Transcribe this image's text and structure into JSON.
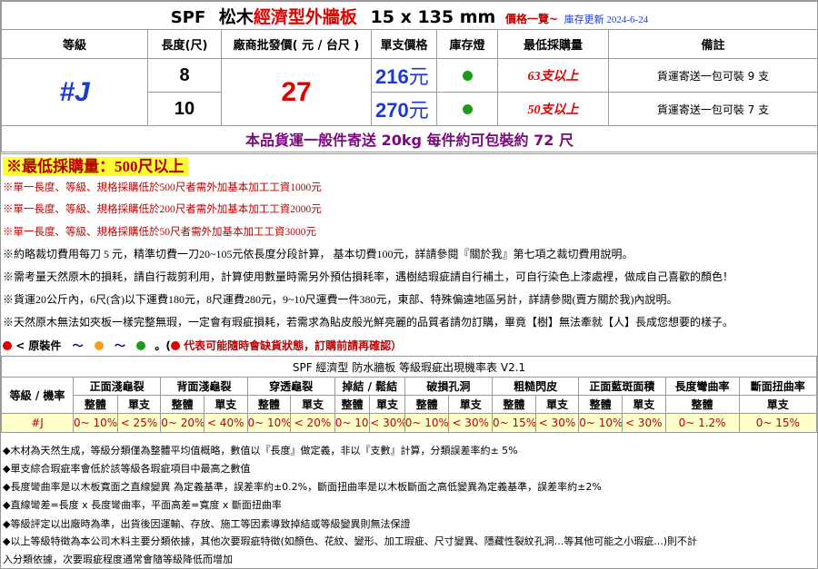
{
  "title": {
    "spf": "SPF",
    "brand": "松木",
    "type": "經濟型外牆板",
    "size": "15 x 135 mm",
    "list": "價格一覽~",
    "update": "庫存更新 2024-6-24"
  },
  "headers": {
    "grade": "等級",
    "length": "長度(尺)",
    "wholesale": "廠商批發價( 元 / 台尺 )",
    "unit_price": "單支價格",
    "stock": "庫存燈",
    "min_buy": "最低採購量",
    "remark": "備註"
  },
  "product": {
    "grade": "#J",
    "wholesale": "27",
    "rows": [
      {
        "length": "8",
        "price": "216",
        "unit": "元",
        "min_buy": "63支以上",
        "remark": "貨運寄送一包可裝 9 支"
      },
      {
        "length": "10",
        "price": "270",
        "unit": "元",
        "min_buy": "50支以上",
        "remark": "貨運寄送一包可裝 7 支"
      }
    ],
    "stock_color": "#1a9b1a",
    "shipping_note": "本品貨運一般件寄送 20kg 每件約可包裝約 72 尺"
  },
  "notes": {
    "min_banner": "※最低採購量：500尺以上",
    "lines_red": [
      "※單一長度、等級、規格採購低於500尺者需外加基本加工工資1000元",
      "※單一長度、等級、規格採購低於200尺者需外加基本加工工資2000元",
      "※單一長度、等級、規格採購低於50尺者需外加基本加工工資3000元"
    ],
    "lines_black": [
      "※約略裁切費用每刀 5 元，精準切費一刀20~105元依長度分段計算， 基本切費100元，詳請參閱『關於我』第七項之裁切費用說明。",
      "※需考量天然原木的損耗，請自行裁剪利用，計算使用數量時需另外預估損耗率，遇樹結瑕疵請自行補土，可自行染色上漆處裡，做成自己喜歡的顏色！",
      "※貨運20公斤內，6尺(含)以下運費180元，8尺運費280元，9~10尺運費一件380元，東部、特殊偏遠地區另計，詳請參閱(賣方關於我)內說明。",
      "※天然原木無法如夾板一樣完整無瑕，一定會有瑕疵損耗，若需求為貼皮般光鮮亮麗的品質者請勿訂購，畢竟【樹】無法牽就【人】長成您想要的樣子。"
    ],
    "legend_label": "< 原裝件",
    "legend_tilde": "～",
    "legend_red_text": "代表可能隨時會缺貨狀態，訂購前請再確認）",
    "legend_colors": [
      "#e00000",
      "#ff9a1a",
      "#1a9b1a"
    ]
  },
  "defect_table": {
    "title": "SPF 經濟型 防水牆板 等級瑕疵出現機率表 V2.1",
    "row_header": "等級 / 機率",
    "groups": [
      "正面淺龜裂",
      "背面淺龜裂",
      "穿透龜裂",
      "掉結 / 鬆結",
      "破損孔洞",
      "粗糙閃皮",
      "正面藍斑面積",
      "長度彎曲率",
      "斷面扭曲率"
    ],
    "sub_whole": "整體",
    "sub_single": "單支",
    "grade": "#J",
    "values": [
      "0~ 10%",
      "< 25%",
      "0~ 20%",
      "< 40%",
      "0~ 10%",
      "< 20%",
      "0~ 10%",
      "< 30%",
      "0~ 10%",
      "< 30%",
      "0~ 15%",
      "< 30%",
      "0~ 10%",
      "< 30%",
      "0~ 1.2%",
      "0~ 15%"
    ]
  },
  "footnotes": [
    "◆木材為天然生成，等級分類僅為整體平均值概略，數值以『長度』做定義，非以『支數』計算，分類誤差率約± 5%",
    "◆單支綜合瑕疵率會低於該等級各瑕疵項目中最高之數值",
    "◆長度彎曲率是以木板寬面之直線變異 為定義基準，誤差率約±0.2%，斷面扭曲率是以木板斷面之高低變異為定義基準，誤差率約±2%",
    "◆直線彎差=長度 x 長度彎曲率，平面高差=寬度 x 斷面扭曲率",
    "◆等級評定以出廠時為準，出貨後因運輸、存放、施工等因素導致掉結或等級變異則無法保證",
    "◆以上等級特徵為本公司木料主要分類依據，其他次要瑕疵特徵(如顏色、花紋、變形、加工瑕疵、尺寸變異、隱藏性裂紋孔洞...等其他可能之小瑕疵...)則不計",
    "入分類依據，次要瑕疵程度通常會隨等級降低而增加"
  ]
}
